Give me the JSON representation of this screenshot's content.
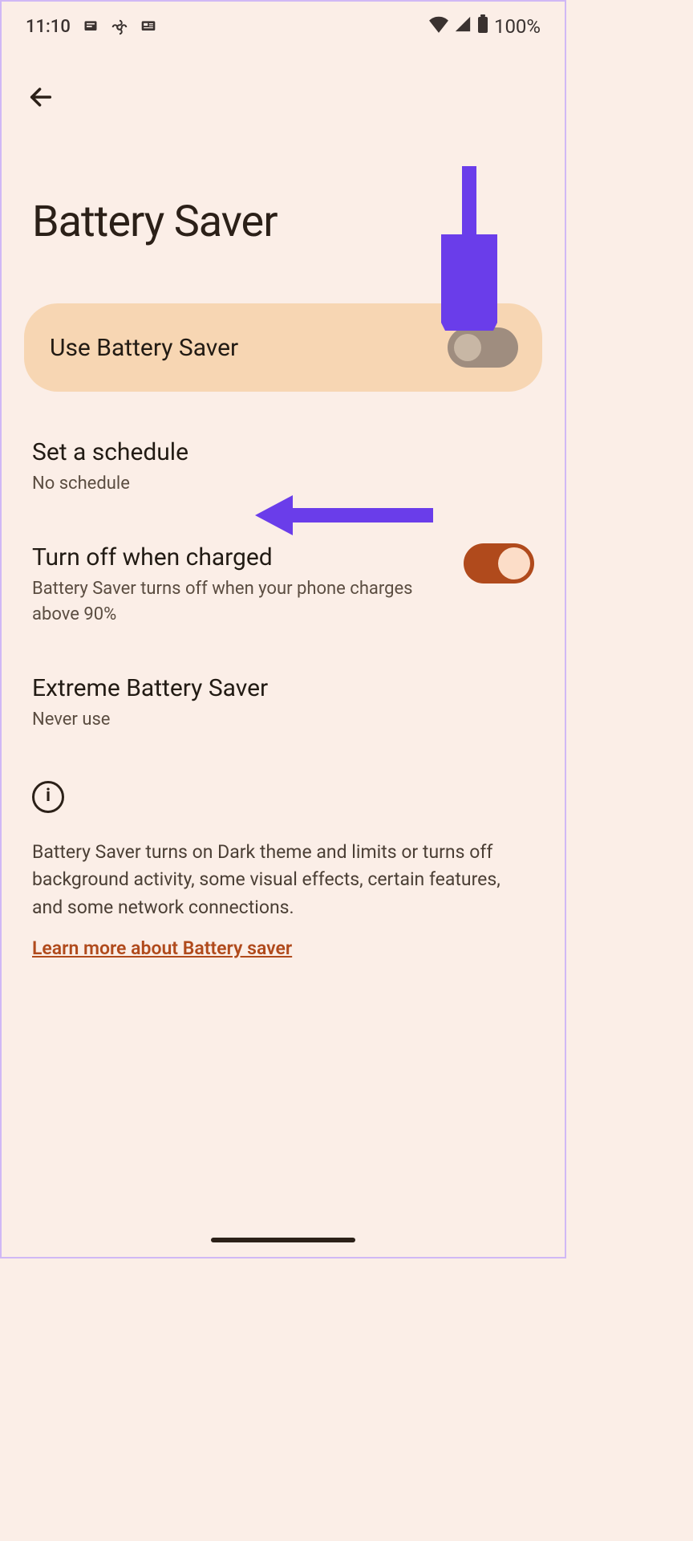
{
  "status": {
    "time": "11:10",
    "battery_percent": "100%"
  },
  "page": {
    "title": "Battery Saver"
  },
  "main_toggle": {
    "label": "Use Battery Saver",
    "state": "off"
  },
  "settings": {
    "schedule": {
      "title": "Set a schedule",
      "subtitle": "No schedule"
    },
    "turn_off_charged": {
      "title": "Turn off when charged",
      "subtitle": "Battery Saver turns off when your phone charges above 90%",
      "state": "on"
    },
    "extreme": {
      "title": "Extreme Battery Saver",
      "subtitle": "Never use"
    }
  },
  "info": {
    "text": "Battery Saver turns on Dark theme and limits or turns off background activity, some visual effects, certain features, and some network connections.",
    "learn_link": "Learn more about Battery saver"
  },
  "annotation": {
    "arrow_color": "#6a3dea"
  }
}
